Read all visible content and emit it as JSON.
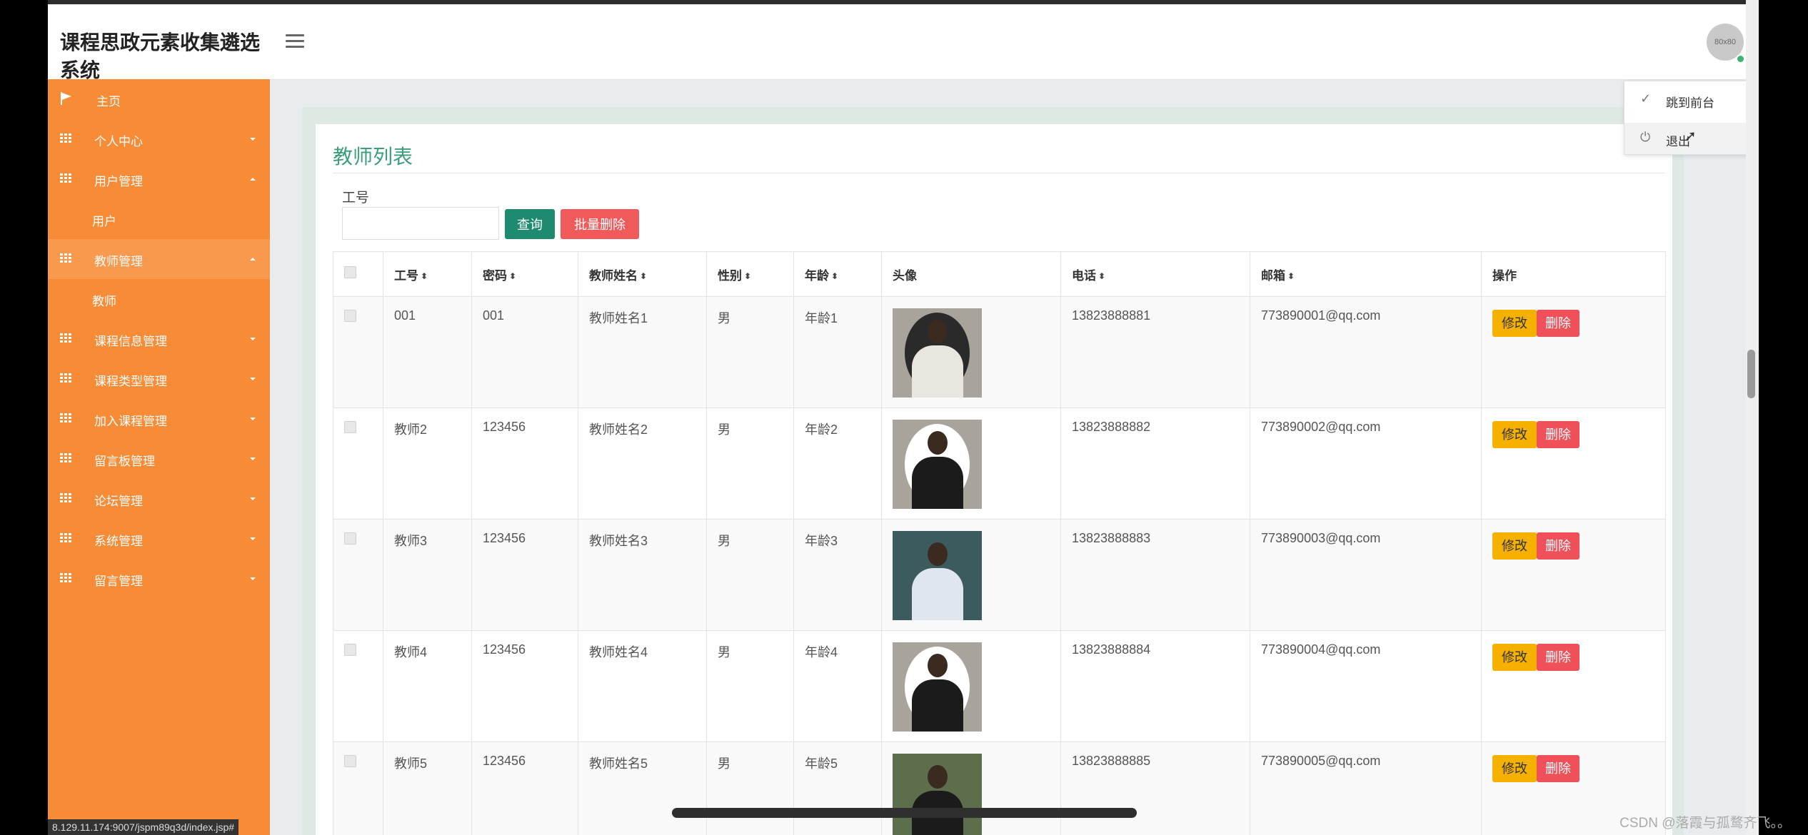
{
  "app": {
    "title": "课程思政元素收集遴选系统",
    "avatar_text": "80x80"
  },
  "sidebar": {
    "items": [
      {
        "label": "主页",
        "icon": "flag-icon"
      },
      {
        "label": "个人中心",
        "icon": "grid-icon"
      },
      {
        "label": "用户管理",
        "icon": "grid-icon"
      },
      {
        "label": "用户",
        "icon": ""
      },
      {
        "label": "教师管理",
        "icon": "grid-icon"
      },
      {
        "label": "教师",
        "icon": ""
      },
      {
        "label": "课程信息管理",
        "icon": "grid-icon"
      },
      {
        "label": "课程类型管理",
        "icon": "grid-icon"
      },
      {
        "label": "加入课程管理",
        "icon": "grid-icon"
      },
      {
        "label": "留言板管理",
        "icon": "grid-icon"
      },
      {
        "label": "论坛管理",
        "icon": "grid-icon"
      },
      {
        "label": "系统管理",
        "icon": "grid-icon"
      },
      {
        "label": "留言管理",
        "icon": "grid-icon"
      }
    ],
    "status_url": "8.129.11.174:9007/jspm89q3d/index.jsp#"
  },
  "dropdown": {
    "items": [
      {
        "label": "跳到前台",
        "icon": "check-icon"
      },
      {
        "label": "退出",
        "icon": "power-icon"
      }
    ]
  },
  "main": {
    "heading": "教师列表",
    "search": {
      "label": "工号",
      "value": "",
      "placeholder": ""
    },
    "query_label": "查询",
    "batch_delete_label": "批量删除",
    "columns": [
      "工号",
      "密码",
      "教师姓名",
      "性别",
      "年龄",
      "头像",
      "电话",
      "邮箱",
      "操作"
    ],
    "rows": [
      {
        "id": "001",
        "password": "001",
        "name": "教师姓名1",
        "gender": "男",
        "age": "年龄1",
        "phone": "13823888881",
        "email": "773890001@qq.com"
      },
      {
        "id": "教师2",
        "password": "123456",
        "name": "教师姓名2",
        "gender": "男",
        "age": "年龄2",
        "phone": "13823888882",
        "email": "773890002@qq.com"
      },
      {
        "id": "教师3",
        "password": "123456",
        "name": "教师姓名3",
        "gender": "男",
        "age": "年龄3",
        "phone": "13823888883",
        "email": "773890003@qq.com"
      },
      {
        "id": "教师4",
        "password": "123456",
        "name": "教师姓名4",
        "gender": "男",
        "age": "年龄4",
        "phone": "13823888884",
        "email": "773890004@qq.com"
      },
      {
        "id": "教师5",
        "password": "123456",
        "name": "教师姓名5",
        "gender": "男",
        "age": "年龄5",
        "phone": "13823888885",
        "email": "773890005@qq.com"
      }
    ],
    "edit_label": "修改",
    "delete_label": "删除"
  },
  "watermark": "CSDN @落霞与孤鹜齐飞。。",
  "colors": {
    "sidebar": "#f88b36",
    "accent": "#3b9f7a",
    "query": "#1e8a6f",
    "danger": "#f05a5a",
    "edit": "#f5b000"
  }
}
